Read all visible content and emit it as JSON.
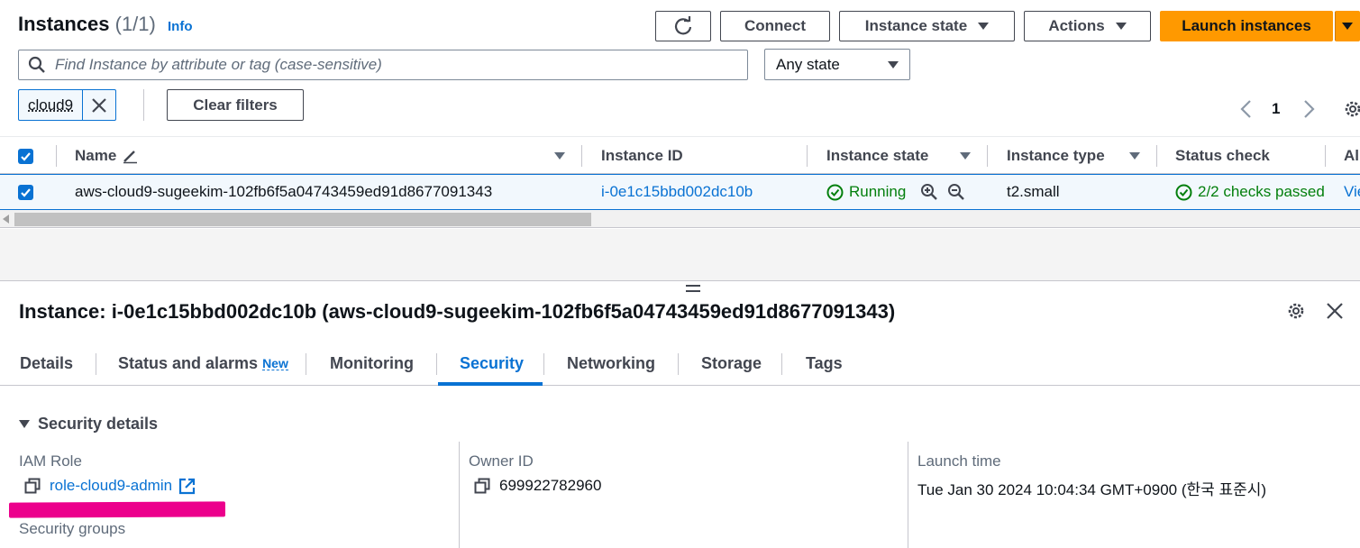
{
  "header": {
    "title": "Instances",
    "count": "(1/1)",
    "info_label": "Info",
    "connect_label": "Connect",
    "instance_state_label": "Instance state",
    "actions_label": "Actions",
    "launch_label": "Launch instances"
  },
  "search": {
    "placeholder": "Find Instance by attribute or tag (case-sensitive)",
    "state_filter": "Any state"
  },
  "filters": {
    "token": "cloud9",
    "clear_label": "Clear filters"
  },
  "pagination": {
    "current_page": "1"
  },
  "table": {
    "columns": [
      "Name",
      "Instance ID",
      "Instance state",
      "Instance type",
      "Status check",
      "Al"
    ],
    "row": {
      "name": "aws-cloud9-sugeekim-102fb6f5a04743459ed91d8677091343",
      "instance_id": "i-0e1c15bbd002dc10b",
      "state": "Running",
      "type": "t2.small",
      "status_check": "2/2 checks passed",
      "alarm": "Vie"
    }
  },
  "detail": {
    "title": "Instance: i-0e1c15bbd002dc10b (aws-cloud9-sugeekim-102fb6f5a04743459ed91d8677091343)",
    "tabs": [
      "Details",
      "Status and alarms",
      "Monitoring",
      "Security",
      "Networking",
      "Storage",
      "Tags"
    ],
    "new_badge": "New",
    "active_tab": "Security",
    "section_title": "Security details",
    "iam_role_label": "IAM Role",
    "iam_role_value": "role-cloud9-admin",
    "owner_id_label": "Owner ID",
    "owner_id_value": "699922782960",
    "launch_time_label": "Launch time",
    "launch_time_value": "Tue Jan 30 2024 10:04:34 GMT+0900 (한국 표준시)",
    "security_groups_label": "Security groups"
  },
  "colors": {
    "primary": "#ff9900",
    "link": "#0972d3",
    "success": "#037f0c",
    "highlight": "#ec008c"
  }
}
